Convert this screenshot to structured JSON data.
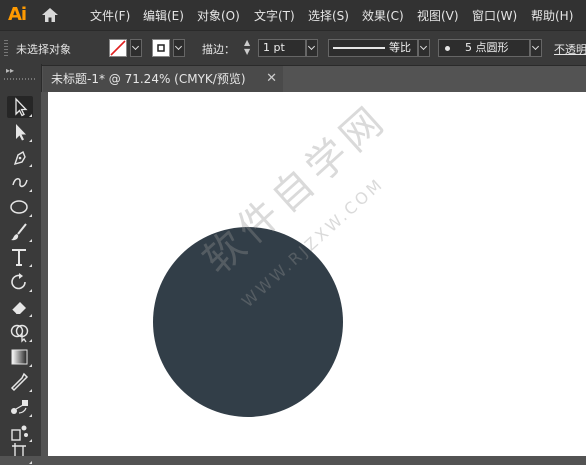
{
  "app": {
    "logo": "Ai"
  },
  "menu": {
    "items": [
      "文件(F)",
      "编辑(E)",
      "对象(O)",
      "文字(T)",
      "选择(S)",
      "效果(C)",
      "视图(V)",
      "窗口(W)",
      "帮助(H)"
    ]
  },
  "control_bar": {
    "selection_status": "未选择对象",
    "stroke_label": "描边：",
    "stroke_weight": "1 pt",
    "profile_label": "等比",
    "brush_label": "5 点圆形",
    "opacity_label": "不透明"
  },
  "document": {
    "tab_title": "未标题-1* @ 71.24% (CMYK/预览)",
    "shape_fill": "#323e48"
  },
  "watermark": {
    "text": "软件自学网",
    "url": "WWW.RJZXW.COM"
  },
  "tools": [
    "selection-tool",
    "direct-selection-tool",
    "pen-tool",
    "curvature-tool",
    "ellipse-tool",
    "paintbrush-tool",
    "type-tool",
    "rotate-tool",
    "eraser-tool",
    "shape-builder-tool",
    "gradient-tool",
    "eyedropper-tool",
    "blend-tool",
    "symbol-sprayer-tool",
    "artboard-tool"
  ]
}
